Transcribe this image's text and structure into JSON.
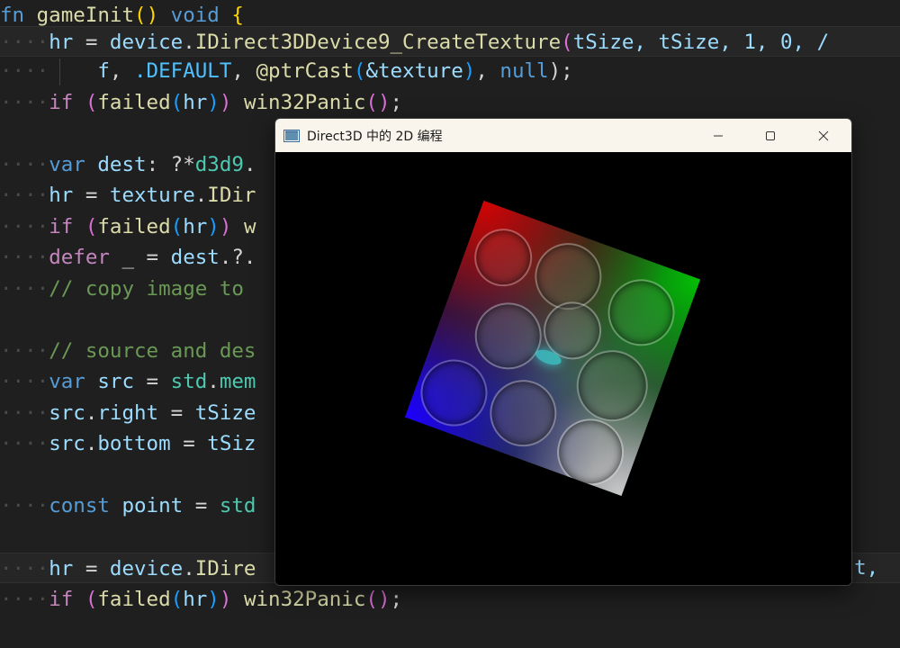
{
  "editor": {
    "line1": {
      "ws": "",
      "kw": "fn",
      "sp1": " ",
      "fname": "gameInit",
      "paren_open": "(",
      "paren_close": ")",
      "sp2": " ",
      "type": "void",
      "sp3": " ",
      "brace": "{"
    },
    "line2": {
      "ws": "····",
      "var": "hr",
      "op": " = ",
      "obj": "device",
      "dot": ".",
      "func": "IDirect3DDevice9_CreateTexture",
      "paren": "(",
      "args": "tSize, tSize, 1, 0, /"
    },
    "line3": {
      "ws": "····",
      "f": "f",
      "sep1": ", ",
      "enum": ".DEFAULT",
      "sep2": ", ",
      "builtin": "@ptrCast",
      "p_open": "(",
      "ref": "&texture",
      "p_close": ")",
      "sep3": ", ",
      "null": "null",
      "end": ");"
    },
    "line4": {
      "ws": "····",
      "kw": "if",
      "sp": " ",
      "p1o": "(",
      "func": "failed",
      "p2o": "(",
      "var": "hr",
      "p2c": ")",
      "p1c": ")",
      "sp2": " ",
      "panic": "win32Panic",
      "call": "()",
      "semi": ";"
    },
    "line6": {
      "ws": "····",
      "kw": "var",
      "sp": " ",
      "name": "dest",
      "rest": ": ?*",
      "type": "d3d9",
      "dot": "."
    },
    "line7": {
      "ws": "····",
      "var": "hr",
      "op": " = ",
      "obj": "texture",
      "dot": ".",
      "func": "IDir"
    },
    "line8": {
      "ws": "····",
      "kw": "if",
      "sp": " ",
      "p1o": "(",
      "func": "failed",
      "p2o": "(",
      "var": "hr",
      "p2c": ")",
      "p1c": ")",
      "sp2": " ",
      "rest": "w"
    },
    "line9": {
      "ws": "····",
      "kw": "defer",
      "rest": " _ = ",
      "obj": "dest",
      "tail": ".?."
    },
    "line10": {
      "ws": "····",
      "comment": "// copy image to"
    },
    "line12": {
      "ws": "····",
      "comment": "// source and des"
    },
    "line13": {
      "ws": "····",
      "kw": "var",
      "sp": " ",
      "name": "src",
      "op": " = ",
      "obj": "std",
      "dot": ".",
      "rest": "mem"
    },
    "line14": {
      "ws": "····",
      "obj": "src",
      "dot": ".",
      "field": "right",
      "op": " = ",
      "rest": "tSize"
    },
    "line15": {
      "ws": "····",
      "obj": "src",
      "dot": ".",
      "field": "bottom",
      "op": " = ",
      "rest": "tSiz"
    },
    "line17": {
      "ws": "····",
      "kw": "const",
      "sp": " ",
      "name": "point",
      "op": " = ",
      "rest": "std"
    },
    "line19": {
      "ws": "····",
      "var": "hr",
      "op": " = ",
      "obj": "device",
      "dot": ".",
      "func": "IDire",
      "tail": "est, "
    },
    "line20": {
      "ws": "····",
      "kw": "if",
      "sp": " ",
      "p1o": "(",
      "func": "failed",
      "p2o": "(",
      "var": "hr",
      "p2c": ")",
      "p1c": ")",
      "sp2": " ",
      "panic": "win32Panic",
      "call": "()",
      "semi": ";"
    }
  },
  "window": {
    "title": "Direct3D 中的 2D 编程",
    "icon": "app-window-icon",
    "controls": {
      "minimize": "minimize-icon",
      "maximize": "maximize-icon",
      "close": "close-icon"
    }
  },
  "colors": {
    "editor_bg": "#1f1f1f",
    "titlebar_bg": "#f9f4ec",
    "client_bg": "#000000"
  }
}
